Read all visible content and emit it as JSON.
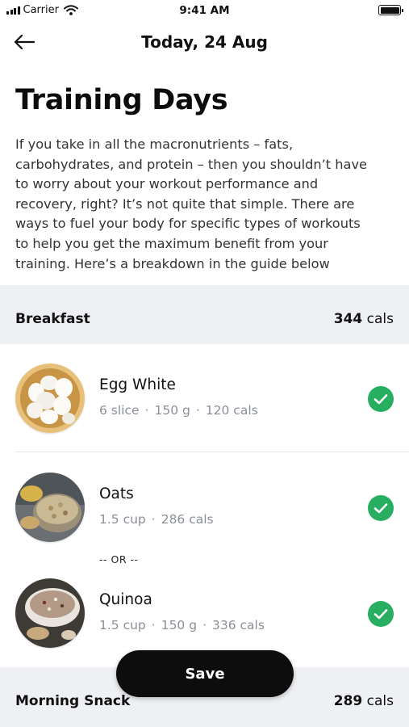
{
  "status_bar": {
    "carrier": "Carrier",
    "time": "9:41 AM",
    "icons": [
      "signal-icon",
      "wifi-icon",
      "battery-icon"
    ]
  },
  "nav": {
    "back_icon": "arrow-left-icon",
    "title": "Today, 24 Aug"
  },
  "page": {
    "title": "Training Days",
    "intro_lines": [
      "If you take in all the macronutrients – fats,",
      "carbohydrates, and protein – then you shouldn’t have",
      "to worry about your workout performance and",
      "recovery, right? It’s not quite that simple. There are",
      "ways to fuel your body for specific types of workouts",
      "to help you get the maximum benefit from your",
      "training. Here’s a breakdown in the guide below"
    ]
  },
  "meals": [
    {
      "title": "Breakfast",
      "cals_value": "344",
      "cals_unit": "cals",
      "items": [
        {
          "name": "Egg White",
          "meta": [
            "6 slice",
            "150 g",
            "120 cals"
          ],
          "checked": true,
          "image_icon": "egg-white-photo"
        },
        {
          "name": "Oats",
          "meta": [
            "1.5 cup",
            "286 cals"
          ],
          "checked": true,
          "image_icon": "oats-photo"
        },
        {
          "name": "Quinoa",
          "meta": [
            "1.5 cup",
            "150 g",
            "336 cals"
          ],
          "checked": true,
          "image_icon": "quinoa-photo"
        }
      ],
      "or_label": "-- OR --"
    },
    {
      "title": "Morning Snack",
      "cals_value": "289",
      "cals_unit": "cals"
    }
  ],
  "actions": {
    "save_label": "Save"
  },
  "colors": {
    "check_green": "#27ae60",
    "section_bg": "#eef0f3",
    "save_button_bg": "#0d0d0d",
    "meta_text": "#8b8f97"
  }
}
